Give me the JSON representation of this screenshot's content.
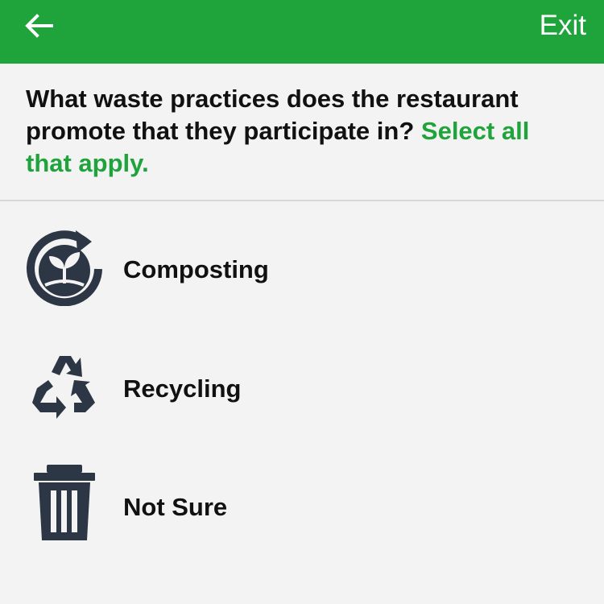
{
  "header": {
    "back_icon": "arrow-left-icon",
    "exit_label": "Exit",
    "background_color": "#1fa33b"
  },
  "question": {
    "text": "What waste practices does the restaurant promote that they participate in?",
    "instruction": "Select all that apply.",
    "accent_color": "#1fa33b"
  },
  "options": [
    {
      "label": "Composting",
      "icon": "compost-icon"
    },
    {
      "label": "Recycling",
      "icon": "recycle-icon"
    },
    {
      "label": "Not Sure",
      "icon": "trash-can-icon"
    }
  ]
}
